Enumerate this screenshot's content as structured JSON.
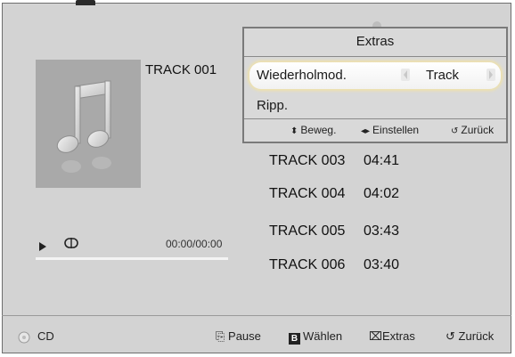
{
  "now_playing": {
    "title": "TRACK 001",
    "time": "00:00/00:00",
    "progress": 0
  },
  "tracks": [
    {
      "name": "TRACK 003",
      "duration": "04:41"
    },
    {
      "name": "TRACK 004",
      "duration": "04:02"
    },
    {
      "name": "TRACK 005",
      "duration": "03:43"
    },
    {
      "name": "TRACK 006",
      "duration": "03:40"
    }
  ],
  "popup": {
    "title": "Extras",
    "rows": [
      {
        "label": "Wiederholmod.",
        "value": "Track"
      },
      {
        "label": "Ripp."
      }
    ],
    "hints": {
      "move": "Beweg.",
      "set": "Einstellen",
      "back": "Zurück"
    }
  },
  "bottom_bar": {
    "source": "CD",
    "pause": "Pause",
    "select_key": "B",
    "select": "Wählen",
    "extras": "Extras",
    "back": "Zurück"
  },
  "icons": {
    "album_art": "music-note-icon",
    "play": "play-icon",
    "repeat": "repeat-icon",
    "disc": "disc-icon"
  },
  "colors": {
    "panel_bg": "#d3d3d3",
    "highlight_glow": "#f0e2a8",
    "album_bg": "#a9a9a9"
  }
}
